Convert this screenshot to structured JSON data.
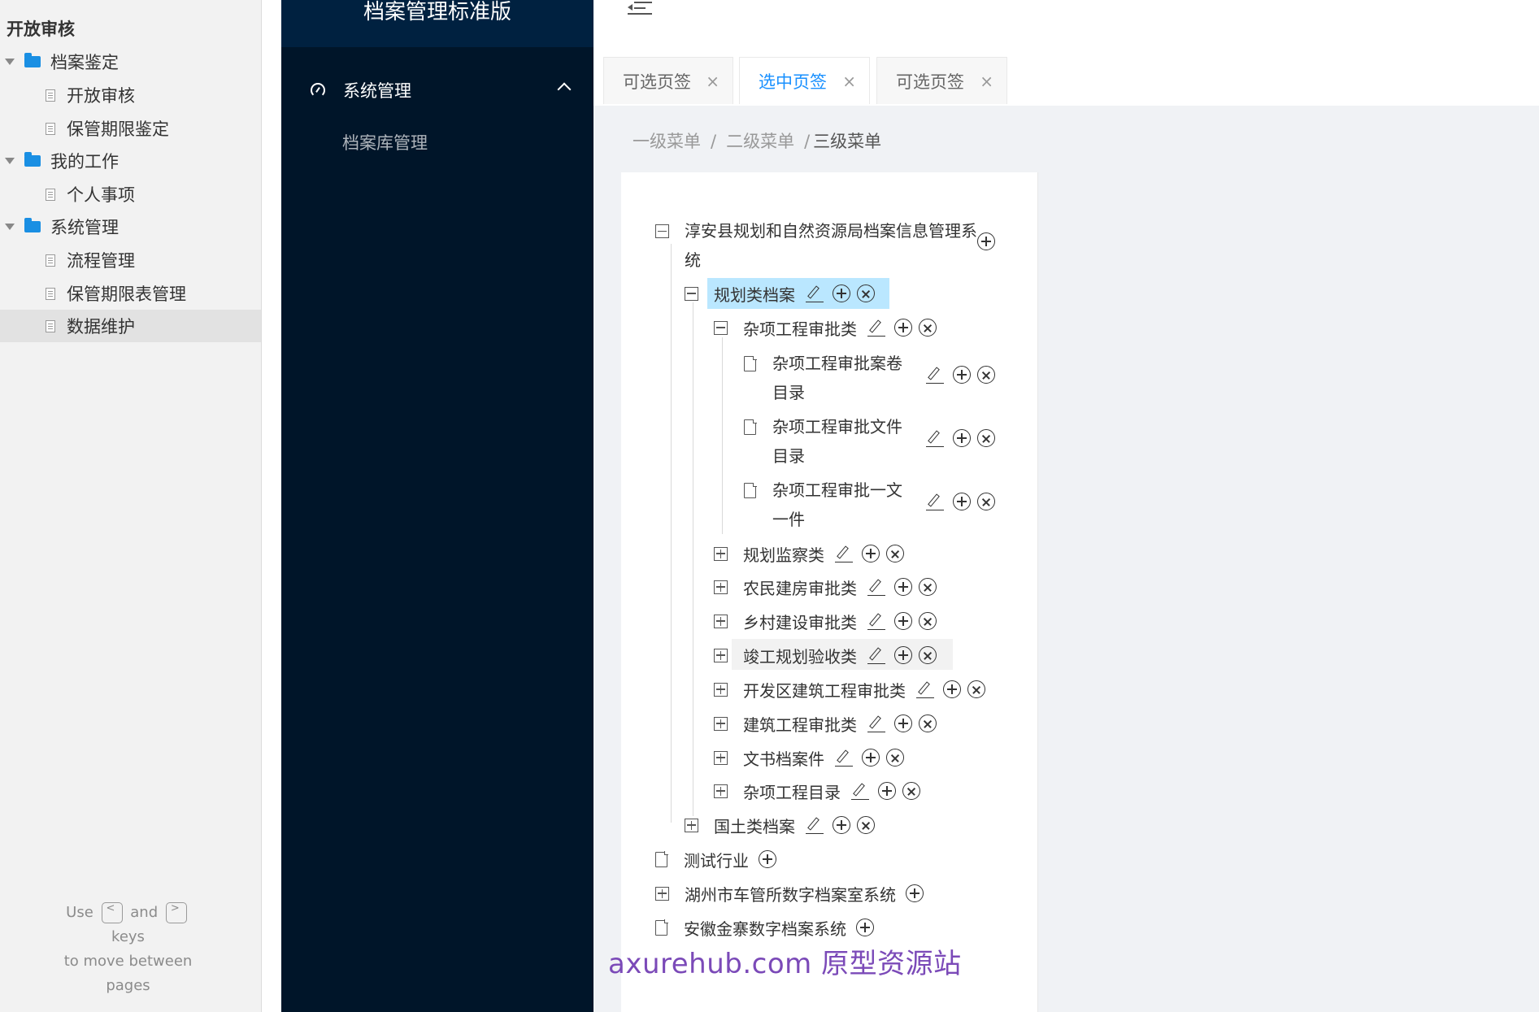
{
  "sidebar": {
    "title": "开放审核",
    "items": [
      {
        "label": "档案鉴定"
      },
      {
        "label": "开放审核"
      },
      {
        "label": "保管期限鉴定"
      },
      {
        "label": "我的工作"
      },
      {
        "label": "个人事项"
      },
      {
        "label": "系统管理"
      },
      {
        "label": "流程管理"
      },
      {
        "label": "保管期限表管理"
      },
      {
        "label": "数据维护"
      }
    ],
    "hint": {
      "use": "Use",
      "prev_key": "<",
      "and": "and",
      "next_key": ">",
      "keys": "keys",
      "line3": "to move between",
      "line4": "pages"
    }
  },
  "nav": {
    "brand": "档案管理标准版",
    "menu_label": "系统管理",
    "submenu_label": "档案库管理"
  },
  "tabs": [
    {
      "label": "可选页签",
      "close": "×"
    },
    {
      "label": "选中页签",
      "close": "×"
    },
    {
      "label": "可选页签",
      "close": "×"
    }
  ],
  "breadcrumb": {
    "level1": "一级菜单",
    "level2": "二级菜单",
    "level3": "三级菜单",
    "sep": "/"
  },
  "tree": {
    "root1": "淳安县规划和自然资源局档案信息管理系统",
    "n_guihua": "规划类档案",
    "n_zaxiang": "杂项工程审批类",
    "n_leaf1": "杂项工程审批案卷目录",
    "n_leaf2": "杂项工程审批文件目录",
    "n_leaf3": "杂项工程审批一文一件",
    "n_jiancha": "规划监察类",
    "n_nongmin": "农民建房审批类",
    "n_xiangcun": "乡村建设审批类",
    "n_jungong": "竣工规划验收类",
    "n_kaifaqu": "开发区建筑工程审批类",
    "n_jianzhu": "建筑工程审批类",
    "n_wenshu": "文书档案件",
    "n_zaxiang_ml": "杂项工程目录",
    "n_guotu": "国土类档案",
    "root2": "测试行业",
    "root3": "湖州市车管所数字档案室系统",
    "root4": "安徽金寨数字档案系统"
  },
  "watermark": "axurehub.com 原型资源站",
  "colors": {
    "nav_bg": "#001529",
    "nav_header": "#002140",
    "accent": "#1890ff",
    "selected_node": "#bae7ff",
    "folder": "#1a8fe3"
  }
}
